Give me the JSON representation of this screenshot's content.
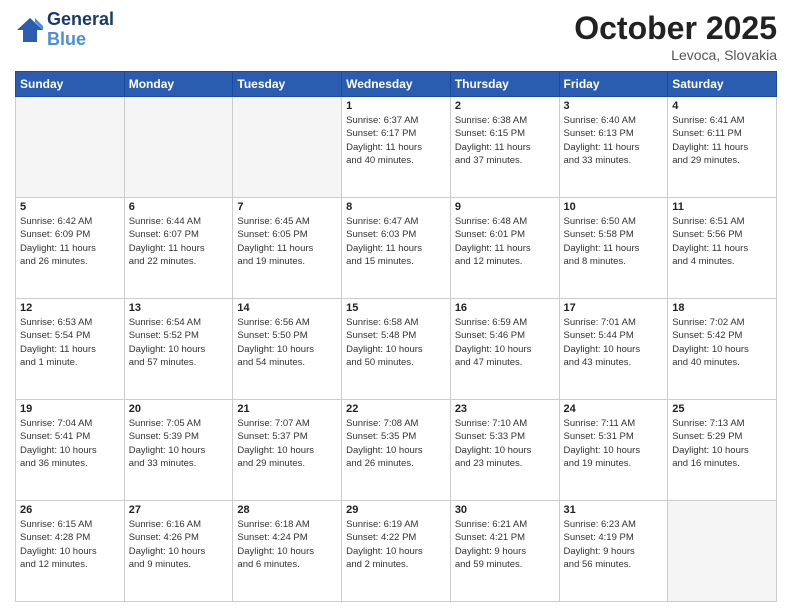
{
  "header": {
    "logo_line1": "General",
    "logo_line2": "Blue",
    "month": "October 2025",
    "location": "Levoca, Slovakia"
  },
  "weekdays": [
    "Sunday",
    "Monday",
    "Tuesday",
    "Wednesday",
    "Thursday",
    "Friday",
    "Saturday"
  ],
  "weeks": [
    [
      {
        "day": "",
        "info": ""
      },
      {
        "day": "",
        "info": ""
      },
      {
        "day": "",
        "info": ""
      },
      {
        "day": "1",
        "info": "Sunrise: 6:37 AM\nSunset: 6:17 PM\nDaylight: 11 hours\nand 40 minutes."
      },
      {
        "day": "2",
        "info": "Sunrise: 6:38 AM\nSunset: 6:15 PM\nDaylight: 11 hours\nand 37 minutes."
      },
      {
        "day": "3",
        "info": "Sunrise: 6:40 AM\nSunset: 6:13 PM\nDaylight: 11 hours\nand 33 minutes."
      },
      {
        "day": "4",
        "info": "Sunrise: 6:41 AM\nSunset: 6:11 PM\nDaylight: 11 hours\nand 29 minutes."
      }
    ],
    [
      {
        "day": "5",
        "info": "Sunrise: 6:42 AM\nSunset: 6:09 PM\nDaylight: 11 hours\nand 26 minutes."
      },
      {
        "day": "6",
        "info": "Sunrise: 6:44 AM\nSunset: 6:07 PM\nDaylight: 11 hours\nand 22 minutes."
      },
      {
        "day": "7",
        "info": "Sunrise: 6:45 AM\nSunset: 6:05 PM\nDaylight: 11 hours\nand 19 minutes."
      },
      {
        "day": "8",
        "info": "Sunrise: 6:47 AM\nSunset: 6:03 PM\nDaylight: 11 hours\nand 15 minutes."
      },
      {
        "day": "9",
        "info": "Sunrise: 6:48 AM\nSunset: 6:01 PM\nDaylight: 11 hours\nand 12 minutes."
      },
      {
        "day": "10",
        "info": "Sunrise: 6:50 AM\nSunset: 5:58 PM\nDaylight: 11 hours\nand 8 minutes."
      },
      {
        "day": "11",
        "info": "Sunrise: 6:51 AM\nSunset: 5:56 PM\nDaylight: 11 hours\nand 4 minutes."
      }
    ],
    [
      {
        "day": "12",
        "info": "Sunrise: 6:53 AM\nSunset: 5:54 PM\nDaylight: 11 hours\nand 1 minute."
      },
      {
        "day": "13",
        "info": "Sunrise: 6:54 AM\nSunset: 5:52 PM\nDaylight: 10 hours\nand 57 minutes."
      },
      {
        "day": "14",
        "info": "Sunrise: 6:56 AM\nSunset: 5:50 PM\nDaylight: 10 hours\nand 54 minutes."
      },
      {
        "day": "15",
        "info": "Sunrise: 6:58 AM\nSunset: 5:48 PM\nDaylight: 10 hours\nand 50 minutes."
      },
      {
        "day": "16",
        "info": "Sunrise: 6:59 AM\nSunset: 5:46 PM\nDaylight: 10 hours\nand 47 minutes."
      },
      {
        "day": "17",
        "info": "Sunrise: 7:01 AM\nSunset: 5:44 PM\nDaylight: 10 hours\nand 43 minutes."
      },
      {
        "day": "18",
        "info": "Sunrise: 7:02 AM\nSunset: 5:42 PM\nDaylight: 10 hours\nand 40 minutes."
      }
    ],
    [
      {
        "day": "19",
        "info": "Sunrise: 7:04 AM\nSunset: 5:41 PM\nDaylight: 10 hours\nand 36 minutes."
      },
      {
        "day": "20",
        "info": "Sunrise: 7:05 AM\nSunset: 5:39 PM\nDaylight: 10 hours\nand 33 minutes."
      },
      {
        "day": "21",
        "info": "Sunrise: 7:07 AM\nSunset: 5:37 PM\nDaylight: 10 hours\nand 29 minutes."
      },
      {
        "day": "22",
        "info": "Sunrise: 7:08 AM\nSunset: 5:35 PM\nDaylight: 10 hours\nand 26 minutes."
      },
      {
        "day": "23",
        "info": "Sunrise: 7:10 AM\nSunset: 5:33 PM\nDaylight: 10 hours\nand 23 minutes."
      },
      {
        "day": "24",
        "info": "Sunrise: 7:11 AM\nSunset: 5:31 PM\nDaylight: 10 hours\nand 19 minutes."
      },
      {
        "day": "25",
        "info": "Sunrise: 7:13 AM\nSunset: 5:29 PM\nDaylight: 10 hours\nand 16 minutes."
      }
    ],
    [
      {
        "day": "26",
        "info": "Sunrise: 6:15 AM\nSunset: 4:28 PM\nDaylight: 10 hours\nand 12 minutes."
      },
      {
        "day": "27",
        "info": "Sunrise: 6:16 AM\nSunset: 4:26 PM\nDaylight: 10 hours\nand 9 minutes."
      },
      {
        "day": "28",
        "info": "Sunrise: 6:18 AM\nSunset: 4:24 PM\nDaylight: 10 hours\nand 6 minutes."
      },
      {
        "day": "29",
        "info": "Sunrise: 6:19 AM\nSunset: 4:22 PM\nDaylight: 10 hours\nand 2 minutes."
      },
      {
        "day": "30",
        "info": "Sunrise: 6:21 AM\nSunset: 4:21 PM\nDaylight: 9 hours\nand 59 minutes."
      },
      {
        "day": "31",
        "info": "Sunrise: 6:23 AM\nSunset: 4:19 PM\nDaylight: 9 hours\nand 56 minutes."
      },
      {
        "day": "",
        "info": ""
      }
    ]
  ]
}
